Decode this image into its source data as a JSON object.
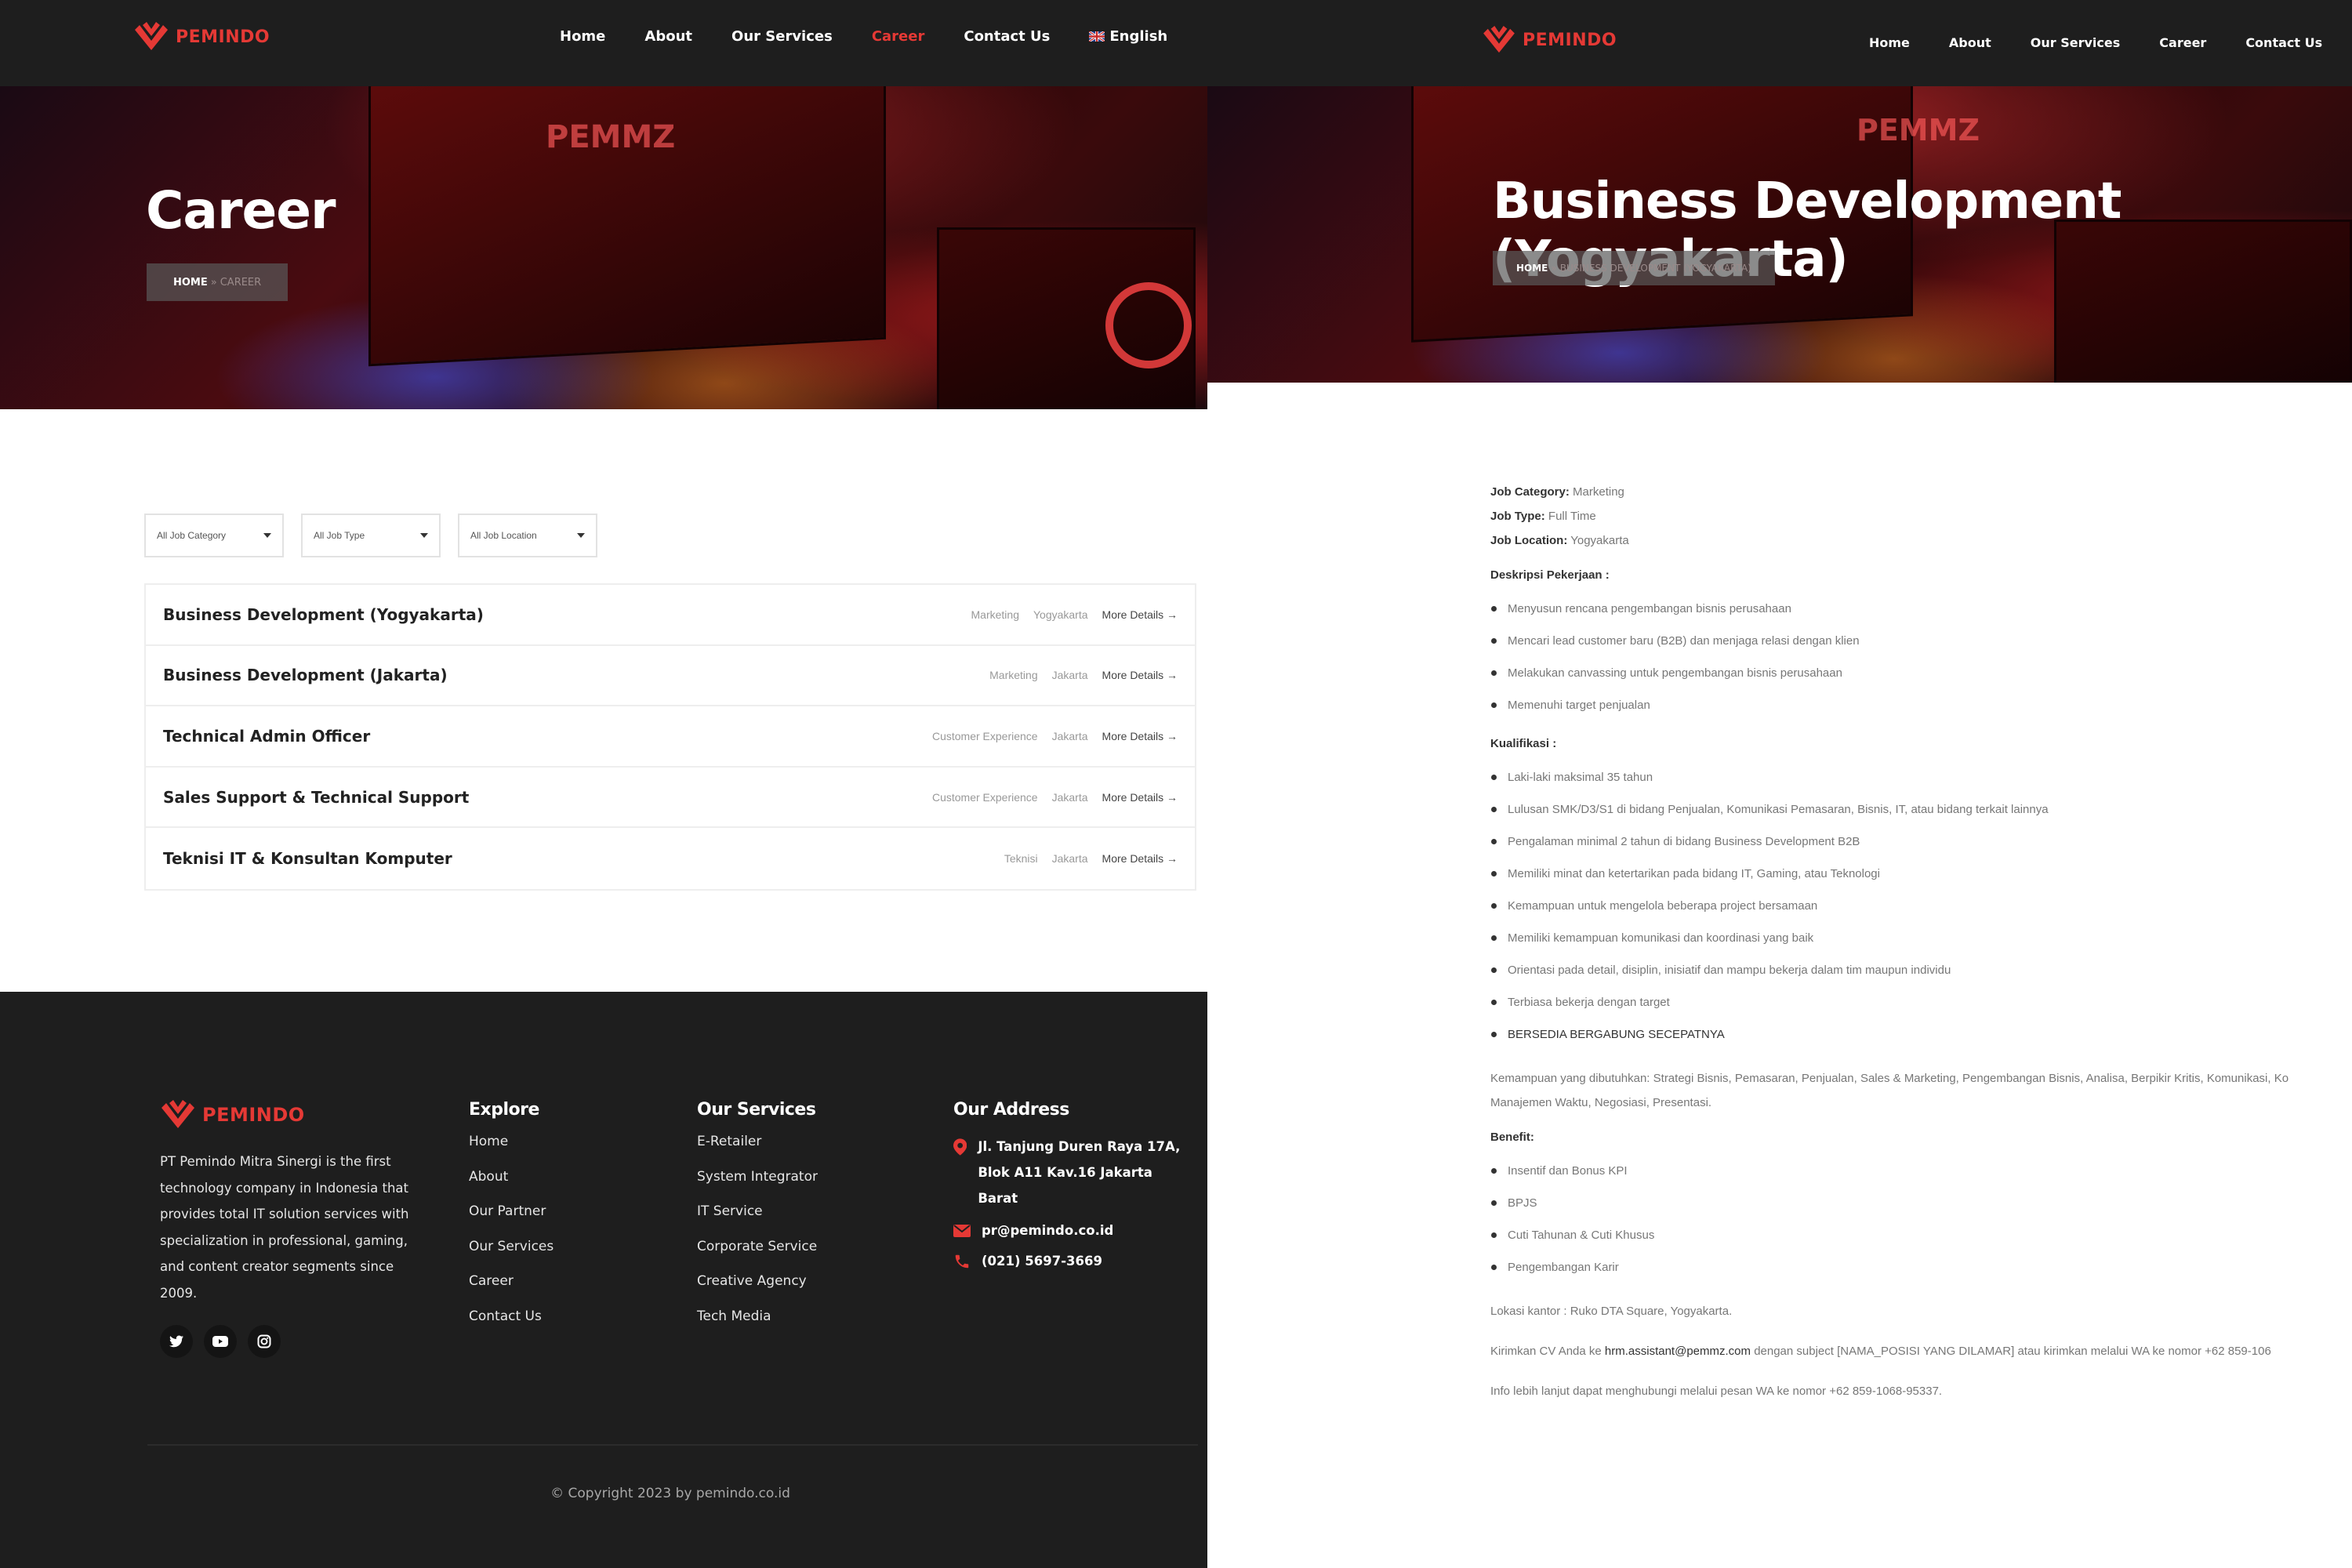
{
  "brand": {
    "name": "PEMINDO",
    "accent": "#e53935",
    "hero_mark": "PEMMZ"
  },
  "career_page": {
    "nav": [
      {
        "label": "Home"
      },
      {
        "label": "About"
      },
      {
        "label": "Our Services"
      },
      {
        "label": "Career",
        "active": true
      },
      {
        "label": "Contact Us"
      }
    ],
    "language": "English",
    "hero_title": "Career",
    "breadcrumb": {
      "home": "HOME",
      "separator": "»",
      "current": "CAREER"
    },
    "filters": [
      {
        "placeholder": "All Job Category"
      },
      {
        "placeholder": "All Job Type"
      },
      {
        "placeholder": "All Job Location"
      }
    ],
    "jobs": [
      {
        "title": "Business Development (Yogyakarta)",
        "category": "Marketing",
        "location": "Yogyakarta",
        "more": "More Details →"
      },
      {
        "title": "Business Development (Jakarta)",
        "category": "Marketing",
        "location": "Jakarta",
        "more": "More Details →"
      },
      {
        "title": "Technical Admin Officer",
        "category": "Customer Experience",
        "location": "Jakarta",
        "more": "More Details →"
      },
      {
        "title": "Sales Support & Technical Support",
        "category": "Customer Experience",
        "location": "Jakarta",
        "more": "More Details →"
      },
      {
        "title": "Teknisi IT & Konsultan Komputer",
        "category": "Teknisi",
        "location": "Jakarta",
        "more": "More Details →"
      }
    ],
    "footer": {
      "about_lines": [
        "PT Pemindo Mitra Sinergi is the first",
        "technology company in Indonesia that",
        "provides total IT solution services with",
        "specialization in professional, gaming,",
        "and content creator segments since",
        "2009."
      ],
      "socials": [
        "twitter-icon",
        "youtube-icon",
        "instagram-icon"
      ],
      "explore_title": "Explore",
      "explore": [
        "Home",
        "About",
        "Our Partner",
        "Our Services",
        "Career",
        "Contact Us"
      ],
      "services_title": "Our Services",
      "services": [
        "E-Retailer",
        "System Integrator",
        "IT Service",
        "Corporate Service",
        "Creative Agency",
        "Tech Media"
      ],
      "address_title": "Our Address",
      "address_lines": [
        "Jl. Tanjung Duren Raya 17A,",
        "Blok A11 Kav.16 Jakarta Barat"
      ],
      "email": "pr@pemindo.co.id",
      "phone": "(021) 5697-3669",
      "copyright": "© Copyright 2023 by pemindo.co.id"
    }
  },
  "detail_page": {
    "nav": [
      {
        "label": "Home"
      },
      {
        "label": "About"
      },
      {
        "label": "Our Services"
      },
      {
        "label": "Career"
      },
      {
        "label": "Contact Us"
      }
    ],
    "hero_title": "Business Development (Yogyakarta)",
    "breadcrumb": {
      "home": "HOME",
      "separator": "»",
      "current": "BUSINESS DEVELOPMENT (YOGYAKARTA)"
    },
    "job_category_label": "Job Category:",
    "job_category": "Marketing",
    "job_type_label": "Job Type:",
    "job_type": "Full Time",
    "job_location_label": "Job Location:",
    "job_location": "Yogyakarta",
    "desc_heading": "Deskripsi Pekerjaan :",
    "desc_items": [
      "Menyusun rencana pengembangan bisnis perusahaan",
      "Mencari lead customer baru (B2B) dan menjaga relasi dengan klien",
      "Melakukan canvassing untuk pengembangan bisnis perusahaan",
      "Memenuhi target penjualan"
    ],
    "qual_heading": "Kualifikasi :",
    "qual_items": [
      "Laki-laki maksimal 35 tahun",
      "Lulusan SMK/D3/S1 di bidang Penjualan, Komunikasi Pemasaran, Bisnis, IT, atau bidang terkait lainnya",
      "Pengalaman minimal 2 tahun di bidang Business Development B2B",
      "Memiliki minat dan ketertarikan pada bidang IT, Gaming, atau Teknologi",
      "Kemampuan untuk mengelola beberapa project bersamaan",
      "Memiliki kemampuan komunikasi dan koordinasi yang baik",
      "Orientasi pada detail, disiplin, inisiatif dan mampu bekerja dalam tim maupun individu",
      "Terbiasa bekerja dengan target",
      "BERSEDIA BERGABUNG SECEPATNYA"
    ],
    "skills_line1": "Kemampuan yang dibutuhkan: Strategi Bisnis, Pemasaran, Penjualan, Sales & Marketing, Pengembangan Bisnis, Analisa, Berpikir Kritis, Komunikasi, Ko",
    "skills_line2": "Manajemen Waktu, Negosiasi, Presentasi.",
    "benefit_heading": "Benefit:",
    "benefit_items": [
      "Insentif dan Bonus KPI",
      "BPJS",
      "Cuti Tahunan & Cuti Khusus",
      "Pengembangan Karir"
    ],
    "office": "Lokasi kantor : Ruko DTA Square, Yogyakarta.",
    "cv_prefix": "Kirimkan CV Anda ke",
    "cv_email": "hrm.assistant@pemmz.com",
    "cv_suffix": "dengan subject [NAMA_POSISI YANG DILAMAR] atau kirimkan melalui WA ke nomor +62 859-106",
    "info": "Info lebih lanjut dapat menghubungi melalui pesan WA ke nomor +62 859-1068-95337."
  }
}
